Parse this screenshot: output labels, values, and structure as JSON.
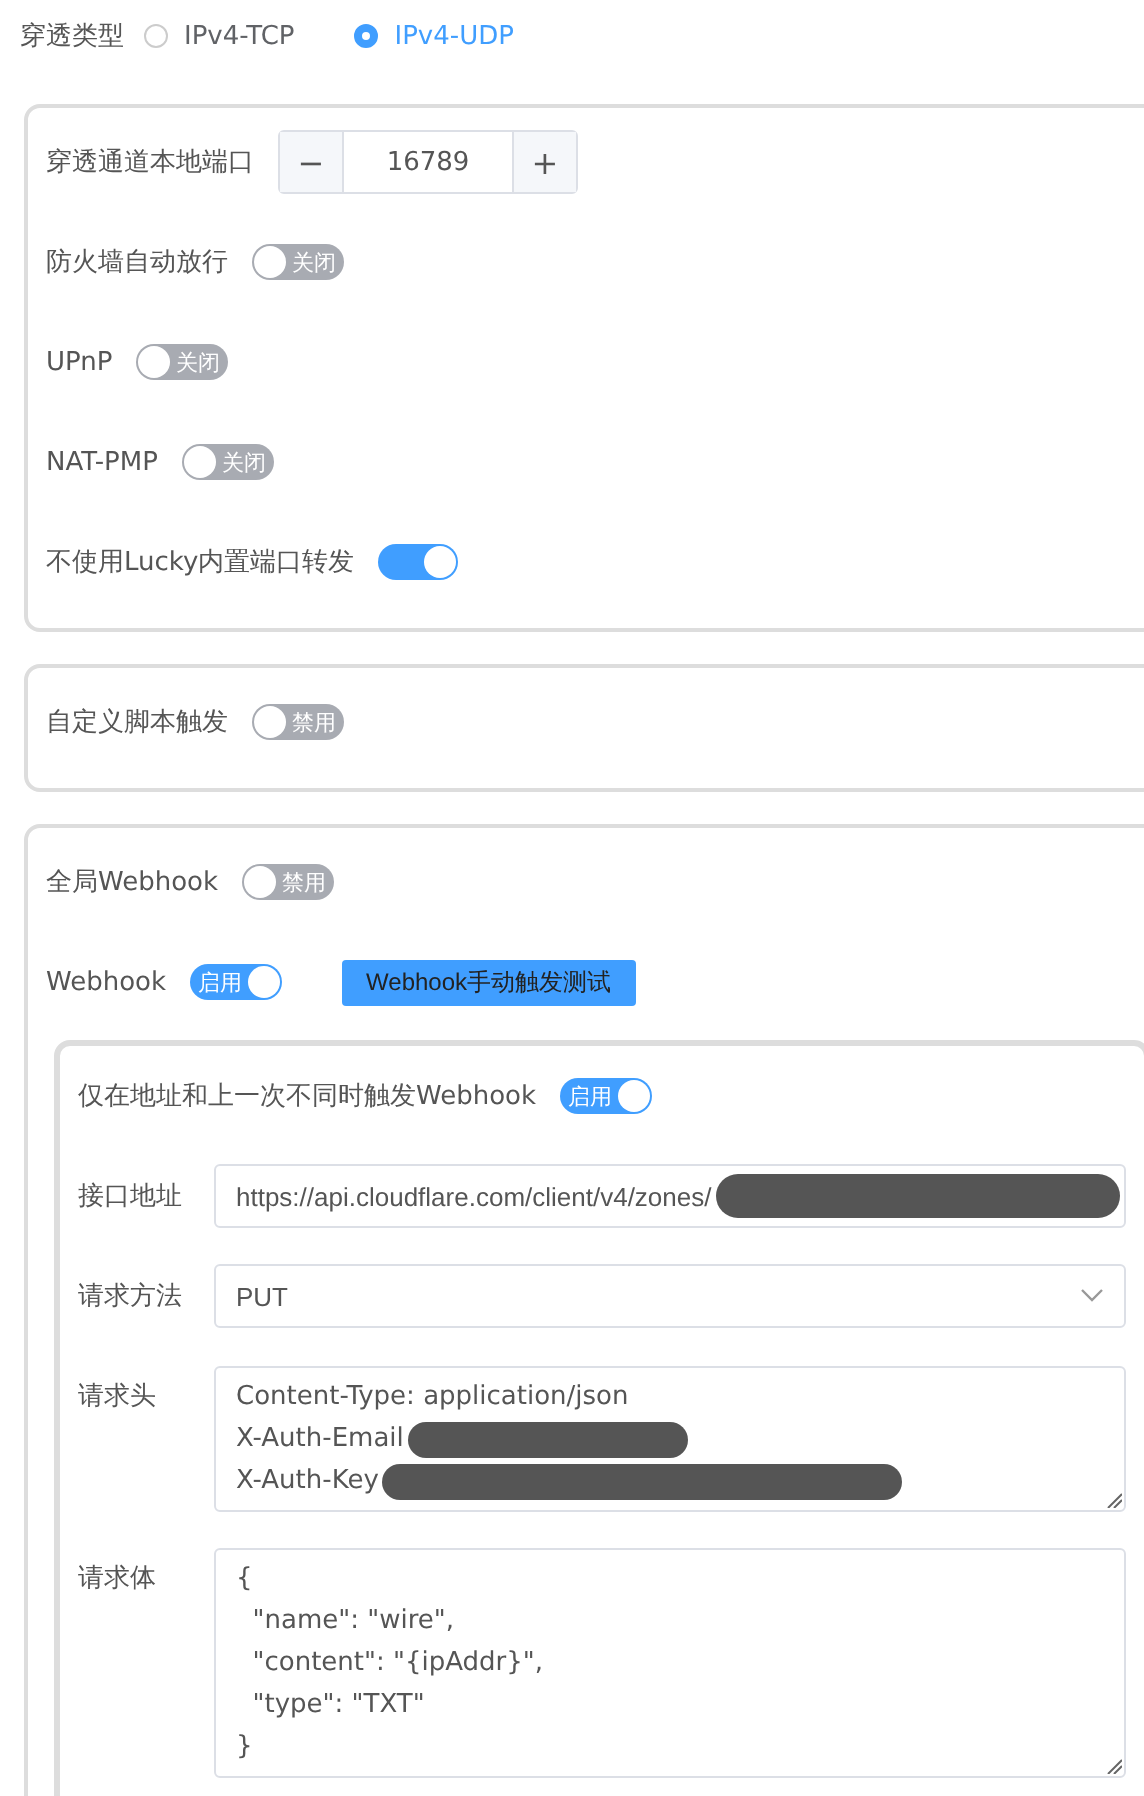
{
  "mode": {
    "label": "穿透类型",
    "options": [
      {
        "label": "IPv4-TCP",
        "selected": false
      },
      {
        "label": "IPv4-UDP",
        "selected": true
      }
    ]
  },
  "sections": [
    {
      "rows": [
        {
          "kind": "stepper",
          "label": "穿透通道本地端口",
          "minus": "−",
          "value": "16789",
          "plus": "+"
        },
        {
          "kind": "switch",
          "label": "防火墙自动放行",
          "on": false,
          "text": "关闭"
        },
        {
          "kind": "switch",
          "label": "UPnP",
          "on": false,
          "text": "关闭"
        },
        {
          "kind": "switch",
          "label": "NAT-PMP",
          "on": false,
          "text": "关闭"
        },
        {
          "kind": "switch",
          "label": "不使用Lucky内置端口转发",
          "on": true
        }
      ]
    },
    {
      "rows": [
        {
          "kind": "switch",
          "label": "自定义脚本触发",
          "on": false,
          "text": "禁用"
        }
      ]
    },
    {
      "rows": [
        {
          "kind": "switch",
          "label": "全局Webhook",
          "on": false,
          "text": "禁用"
        },
        {
          "kind": "switch",
          "label": "Webhook",
          "on": true,
          "text": "启用",
          "button": "Webhook手动触发测试"
        }
      ],
      "subpanel": {
        "rows": [
          {
            "kind": "switch",
            "label": "仅在地址和上一次不同时触发Webhook",
            "on": true,
            "text": "启用"
          },
          {
            "kind": "input",
            "label": "接口地址",
            "value": "https://api.cloudflare.com/client/v4/zones/",
            "redacted": true
          },
          {
            "kind": "select",
            "label": "请求方法",
            "value": "PUT"
          },
          {
            "kind": "textarea",
            "label": "请求头",
            "lines": [
              {
                "text": "Content-Type: application/json"
              },
              {
                "text": "X-Auth-Email",
                "redacted": true
              },
              {
                "text": "X-Auth-Key",
                "redacted": true
              }
            ]
          },
          {
            "kind": "textarea",
            "label": "请求体",
            "lines": [
              {
                "text": "{"
              },
              {
                "text": "  \"name\": \"wire\","
              },
              {
                "text": "  \"content\": \"{ipAddr}\","
              },
              {
                "text": "  \"type\": \"TXT\""
              },
              {
                "text": "}"
              }
            ]
          }
        ]
      }
    }
  ]
}
